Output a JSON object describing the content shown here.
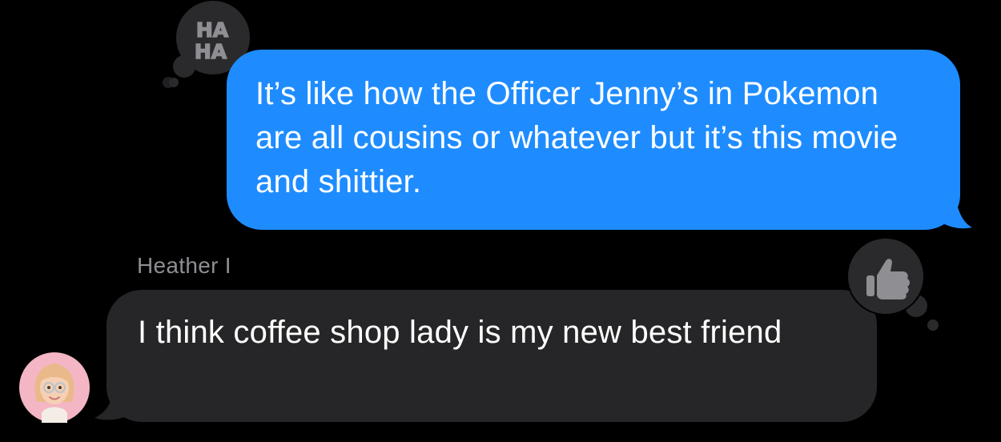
{
  "thread": {
    "outgoing_message": {
      "text": "It’s like how the Officer Jenny’s in Pokemon are all cousins or whatever but it’s this movie and shittier.",
      "tapback": {
        "type": "haha",
        "label_line1": "HA",
        "label_line2": "HA"
      },
      "bubble_color": "#1e8cff"
    },
    "incoming_message": {
      "sender_name": "Heather I",
      "text": "I think coffee shop lady is my new best friend",
      "tapback": {
        "type": "like",
        "icon": "thumbs-up-icon"
      },
      "bubble_color": "#262628",
      "avatar": {
        "icon": "memoji-avatar",
        "background": "#f4b6c4"
      }
    }
  },
  "colors": {
    "background": "#000000",
    "tapback_bubble": "#2a2a2c",
    "tapback_glyph": "#8e8e93",
    "sender_name": "#8e8e93"
  }
}
